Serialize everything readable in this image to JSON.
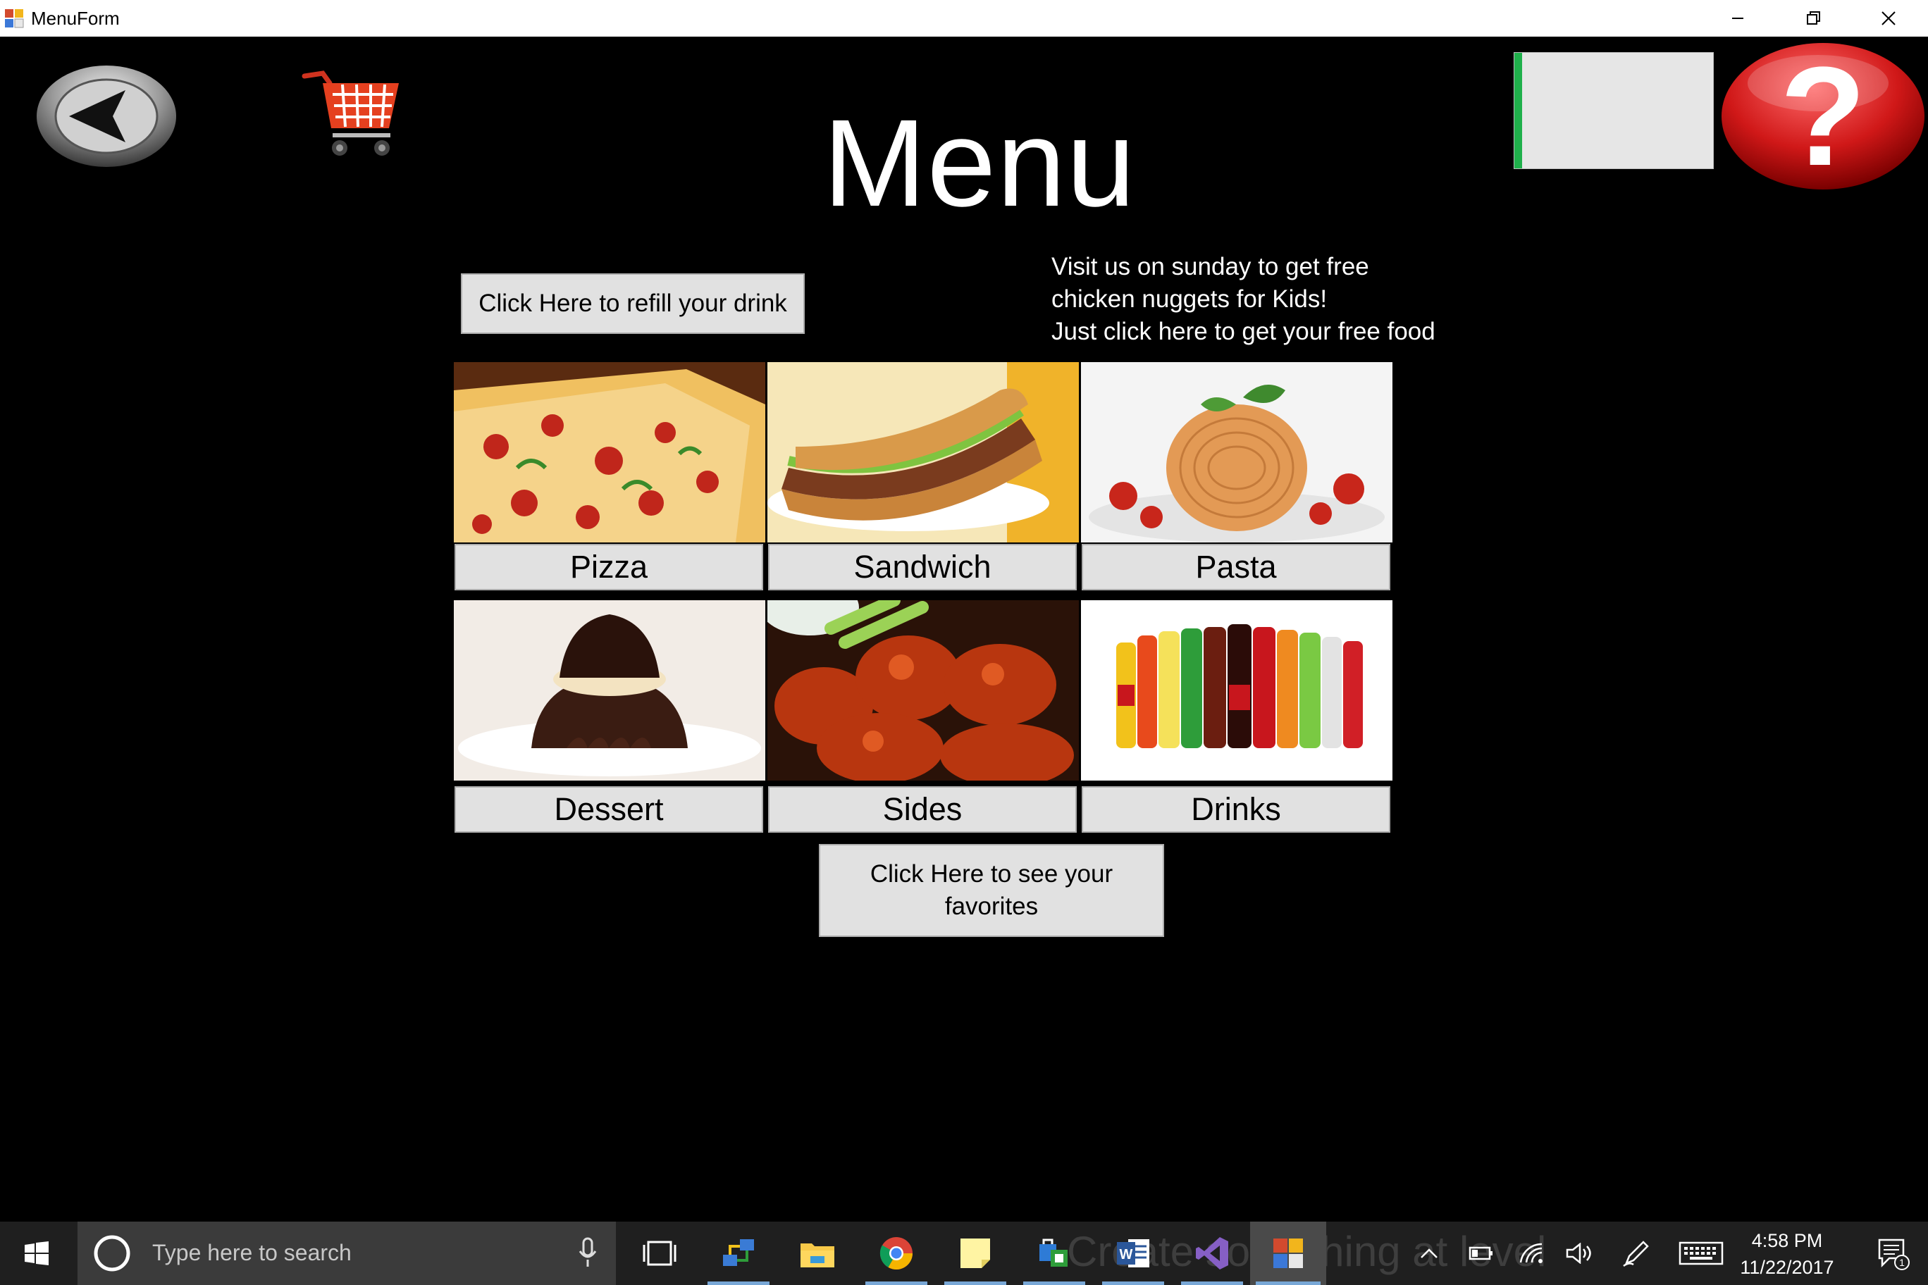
{
  "window": {
    "title": "MenuForm",
    "controls": [
      "minimize",
      "restore",
      "close"
    ]
  },
  "header": {
    "title": "Menu",
    "back_icon": "back-arrow-icon",
    "cart_icon": "shopping-cart-icon",
    "help_icon": "question-mark-icon",
    "progress_fraction": 0.04,
    "progress_color": "#1fb04b"
  },
  "actions": {
    "refill_label": "Click Here to refill your drink",
    "favorites_label": "Click Here to see your favorites"
  },
  "promo": {
    "lines": [
      "Visit us on sunday to get free",
      "chicken nuggets for Kids!",
      "Just click here to get your free food"
    ]
  },
  "categories": [
    {
      "label": "Pizza",
      "image": "pizza-image"
    },
    {
      "label": "Sandwich",
      "image": "sandwich-image"
    },
    {
      "label": "Pasta",
      "image": "pasta-image"
    },
    {
      "label": "Dessert",
      "image": "dessert-image"
    },
    {
      "label": "Sides",
      "image": "sides-image"
    },
    {
      "label": "Drinks",
      "image": "drinks-image"
    }
  ],
  "taskbar": {
    "search_placeholder": "Type here to search",
    "ghost_text": "Create something at level",
    "time": "4:58 PM",
    "date": "11/22/2017",
    "notification_count": "1",
    "pinned": [
      "task-view-icon",
      "network-app-icon",
      "file-explorer-icon",
      "chrome-icon",
      "sticky-notes-icon",
      "store-icon",
      "word-icon",
      "visual-studio-icon",
      "menuform-app-icon"
    ]
  }
}
